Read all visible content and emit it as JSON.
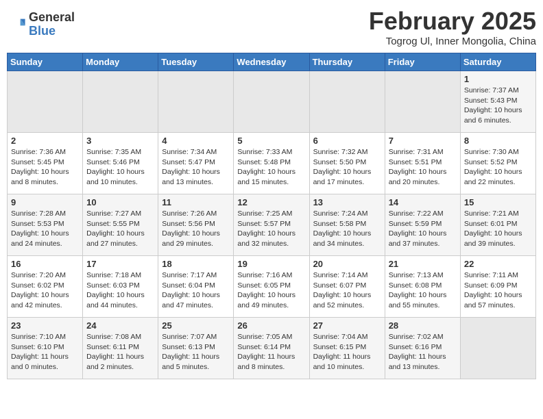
{
  "header": {
    "logo_general": "General",
    "logo_blue": "Blue",
    "month_title": "February 2025",
    "location": "Togrog Ul, Inner Mongolia, China"
  },
  "days_of_week": [
    "Sunday",
    "Monday",
    "Tuesday",
    "Wednesday",
    "Thursday",
    "Friday",
    "Saturday"
  ],
  "weeks": [
    [
      {
        "num": "",
        "info": ""
      },
      {
        "num": "",
        "info": ""
      },
      {
        "num": "",
        "info": ""
      },
      {
        "num": "",
        "info": ""
      },
      {
        "num": "",
        "info": ""
      },
      {
        "num": "",
        "info": ""
      },
      {
        "num": "1",
        "info": "Sunrise: 7:37 AM\nSunset: 5:43 PM\nDaylight: 10 hours\nand 6 minutes."
      }
    ],
    [
      {
        "num": "2",
        "info": "Sunrise: 7:36 AM\nSunset: 5:45 PM\nDaylight: 10 hours\nand 8 minutes."
      },
      {
        "num": "3",
        "info": "Sunrise: 7:35 AM\nSunset: 5:46 PM\nDaylight: 10 hours\nand 10 minutes."
      },
      {
        "num": "4",
        "info": "Sunrise: 7:34 AM\nSunset: 5:47 PM\nDaylight: 10 hours\nand 13 minutes."
      },
      {
        "num": "5",
        "info": "Sunrise: 7:33 AM\nSunset: 5:48 PM\nDaylight: 10 hours\nand 15 minutes."
      },
      {
        "num": "6",
        "info": "Sunrise: 7:32 AM\nSunset: 5:50 PM\nDaylight: 10 hours\nand 17 minutes."
      },
      {
        "num": "7",
        "info": "Sunrise: 7:31 AM\nSunset: 5:51 PM\nDaylight: 10 hours\nand 20 minutes."
      },
      {
        "num": "8",
        "info": "Sunrise: 7:30 AM\nSunset: 5:52 PM\nDaylight: 10 hours\nand 22 minutes."
      }
    ],
    [
      {
        "num": "9",
        "info": "Sunrise: 7:28 AM\nSunset: 5:53 PM\nDaylight: 10 hours\nand 24 minutes."
      },
      {
        "num": "10",
        "info": "Sunrise: 7:27 AM\nSunset: 5:55 PM\nDaylight: 10 hours\nand 27 minutes."
      },
      {
        "num": "11",
        "info": "Sunrise: 7:26 AM\nSunset: 5:56 PM\nDaylight: 10 hours\nand 29 minutes."
      },
      {
        "num": "12",
        "info": "Sunrise: 7:25 AM\nSunset: 5:57 PM\nDaylight: 10 hours\nand 32 minutes."
      },
      {
        "num": "13",
        "info": "Sunrise: 7:24 AM\nSunset: 5:58 PM\nDaylight: 10 hours\nand 34 minutes."
      },
      {
        "num": "14",
        "info": "Sunrise: 7:22 AM\nSunset: 5:59 PM\nDaylight: 10 hours\nand 37 minutes."
      },
      {
        "num": "15",
        "info": "Sunrise: 7:21 AM\nSunset: 6:01 PM\nDaylight: 10 hours\nand 39 minutes."
      }
    ],
    [
      {
        "num": "16",
        "info": "Sunrise: 7:20 AM\nSunset: 6:02 PM\nDaylight: 10 hours\nand 42 minutes."
      },
      {
        "num": "17",
        "info": "Sunrise: 7:18 AM\nSunset: 6:03 PM\nDaylight: 10 hours\nand 44 minutes."
      },
      {
        "num": "18",
        "info": "Sunrise: 7:17 AM\nSunset: 6:04 PM\nDaylight: 10 hours\nand 47 minutes."
      },
      {
        "num": "19",
        "info": "Sunrise: 7:16 AM\nSunset: 6:05 PM\nDaylight: 10 hours\nand 49 minutes."
      },
      {
        "num": "20",
        "info": "Sunrise: 7:14 AM\nSunset: 6:07 PM\nDaylight: 10 hours\nand 52 minutes."
      },
      {
        "num": "21",
        "info": "Sunrise: 7:13 AM\nSunset: 6:08 PM\nDaylight: 10 hours\nand 55 minutes."
      },
      {
        "num": "22",
        "info": "Sunrise: 7:11 AM\nSunset: 6:09 PM\nDaylight: 10 hours\nand 57 minutes."
      }
    ],
    [
      {
        "num": "23",
        "info": "Sunrise: 7:10 AM\nSunset: 6:10 PM\nDaylight: 11 hours\nand 0 minutes."
      },
      {
        "num": "24",
        "info": "Sunrise: 7:08 AM\nSunset: 6:11 PM\nDaylight: 11 hours\nand 2 minutes."
      },
      {
        "num": "25",
        "info": "Sunrise: 7:07 AM\nSunset: 6:13 PM\nDaylight: 11 hours\nand 5 minutes."
      },
      {
        "num": "26",
        "info": "Sunrise: 7:05 AM\nSunset: 6:14 PM\nDaylight: 11 hours\nand 8 minutes."
      },
      {
        "num": "27",
        "info": "Sunrise: 7:04 AM\nSunset: 6:15 PM\nDaylight: 11 hours\nand 10 minutes."
      },
      {
        "num": "28",
        "info": "Sunrise: 7:02 AM\nSunset: 6:16 PM\nDaylight: 11 hours\nand 13 minutes."
      },
      {
        "num": "",
        "info": ""
      }
    ]
  ]
}
